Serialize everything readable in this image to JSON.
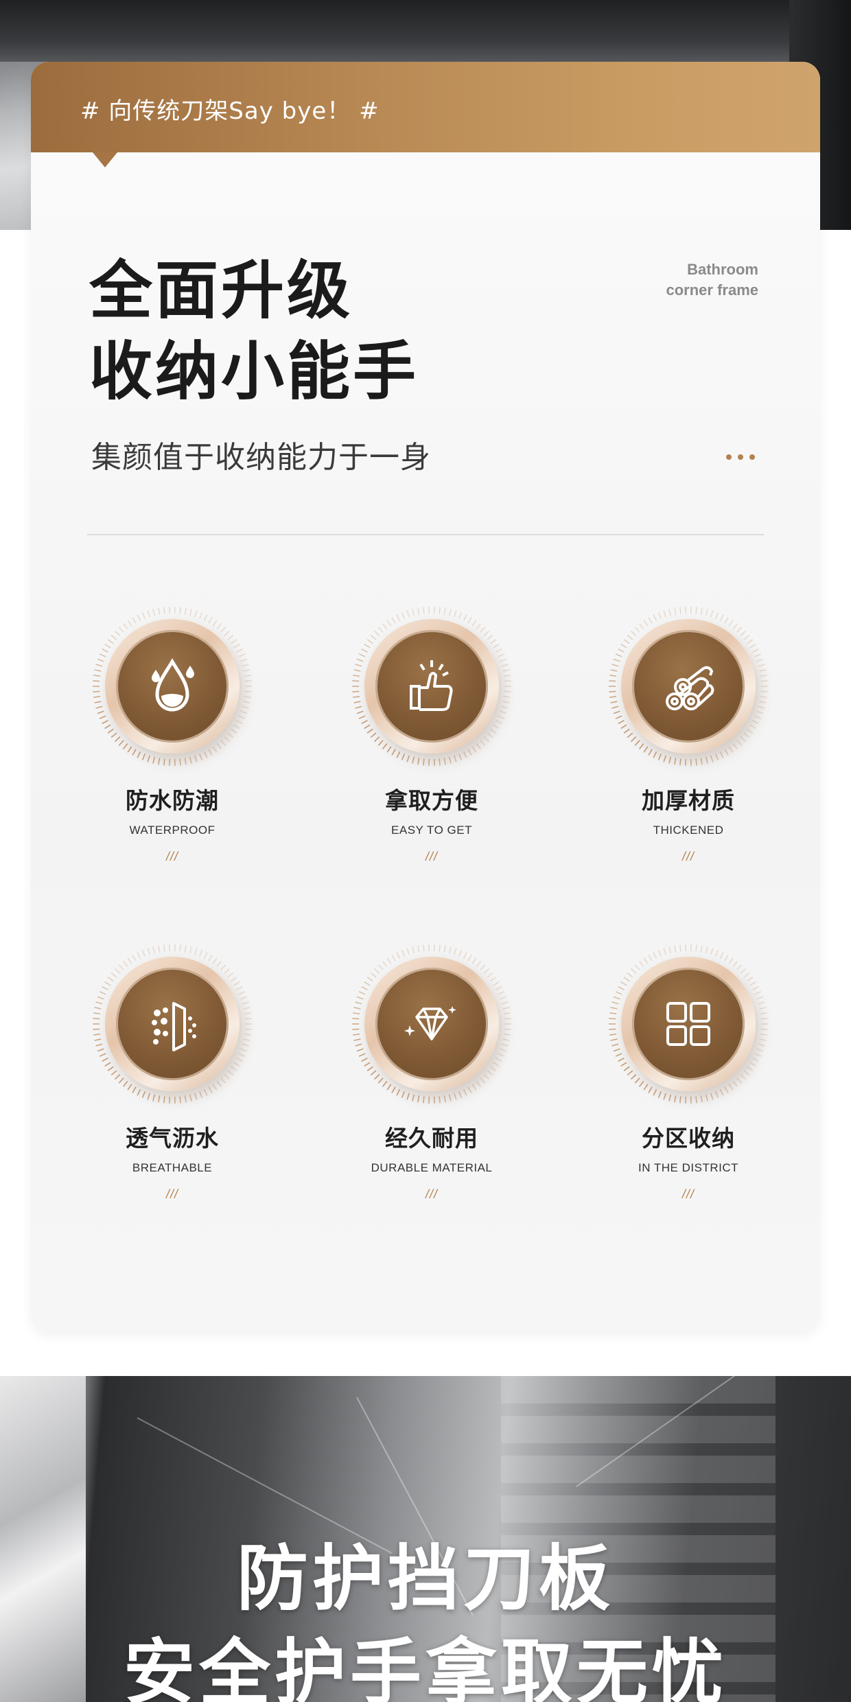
{
  "header": {
    "tag": "# 向传统刀架Say bye！ #"
  },
  "hero": {
    "title_line1": "全面升级",
    "title_line2": "收纳小能手",
    "english_line1": "Bathroom",
    "english_line2": "corner frame",
    "subtitle": "集颜值于收纳能力于一身"
  },
  "features": [
    {
      "cn": "防水防潮",
      "en": "WATERPROOF",
      "mark": "///",
      "icon": "water-drop-icon"
    },
    {
      "cn": "拿取方便",
      "en": "EASY TO GET",
      "mark": "///",
      "icon": "thumbs-up-icon"
    },
    {
      "cn": "加厚材质",
      "en": "THICKENED",
      "mark": "///",
      "icon": "stacked-logs-icon"
    },
    {
      "cn": "透气沥水",
      "en": "BREATHABLE",
      "mark": "///",
      "icon": "breathable-door-icon"
    },
    {
      "cn": "经久耐用",
      "en": "DURABLE MATERIAL",
      "mark": "///",
      "icon": "diamond-icon"
    },
    {
      "cn": "分区收纳",
      "en": "IN THE DISTRICT",
      "mark": "///",
      "icon": "grid-icon"
    }
  ],
  "banner": {
    "line1": "防护挡刀板",
    "line2": "安全护手拿取无忧"
  },
  "colors": {
    "accent": "#b3824f",
    "header_start": "#9c6c3d",
    "header_end": "#cfa46c",
    "medal_inner": "#805a35"
  }
}
